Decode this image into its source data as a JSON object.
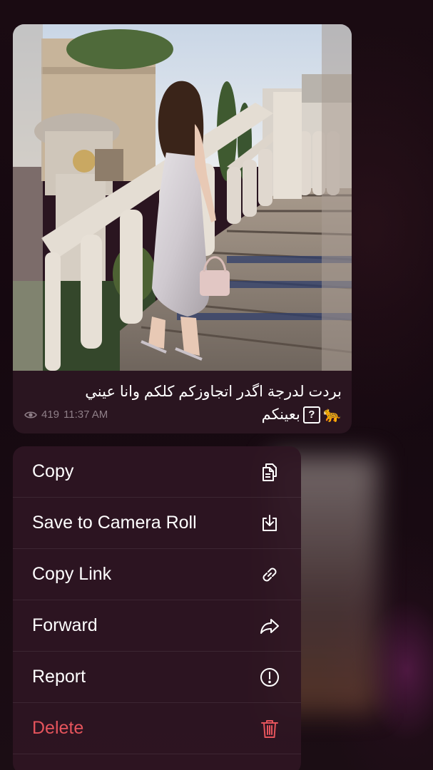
{
  "message": {
    "caption_line1": "بردت لدرجة اگدر اتجاوزكم كلكم وانا عيني",
    "caption_line2": "بعينكم",
    "caption_emoji": "🐆",
    "views": "419",
    "time": "11:37 AM"
  },
  "context_menu": {
    "items": [
      {
        "label": "Copy",
        "icon": "copy-icon"
      },
      {
        "label": "Save to Camera Roll",
        "icon": "download-icon"
      },
      {
        "label": "Copy Link",
        "icon": "link-icon"
      },
      {
        "label": "Forward",
        "icon": "forward-icon"
      },
      {
        "label": "Report",
        "icon": "report-icon"
      },
      {
        "label": "Delete",
        "icon": "trash-icon",
        "color": "#e5545c"
      }
    ]
  },
  "colors": {
    "background": "#150810",
    "bubble": "#2a1520",
    "menu": "#2e1622",
    "danger": "#e5545c",
    "meta_text": "#8f7f88"
  }
}
